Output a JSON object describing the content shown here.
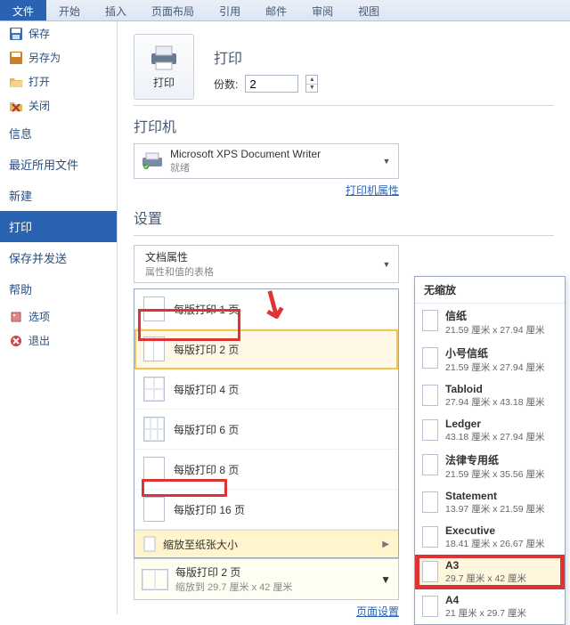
{
  "ribbon": {
    "tabs": [
      "文件",
      "开始",
      "插入",
      "页面布局",
      "引用",
      "邮件",
      "审阅",
      "视图"
    ],
    "active_index": 0
  },
  "left_menu": {
    "quick": [
      {
        "icon": "save-icon",
        "label": "保存"
      },
      {
        "icon": "saveas-icon",
        "label": "另存为"
      },
      {
        "icon": "open-icon",
        "label": "打开"
      },
      {
        "icon": "close-icon",
        "label": "关闭"
      }
    ],
    "sections": [
      "信息",
      "最近所用文件",
      "新建",
      "打印",
      "保存并发送",
      "帮助"
    ],
    "selected_section_index": 3,
    "footer": [
      {
        "icon": "options-icon",
        "label": "选项"
      },
      {
        "icon": "exit-icon",
        "label": "退出"
      }
    ]
  },
  "print": {
    "title": "打印",
    "button_label": "打印",
    "copies_label": "份数:",
    "copies_value": "2"
  },
  "printer": {
    "heading": "打印机",
    "name": "Microsoft XPS Document Writer",
    "status": "就绪",
    "props_link": "打印机属性"
  },
  "settings": {
    "heading": "设置",
    "doc_props": {
      "main": "文档属性",
      "sub": "属性和值的表格"
    },
    "pages_per_sheet": {
      "items": [
        "每版打印 1 页",
        "每版打印 2 页",
        "每版打印 4 页",
        "每版打印 6 页",
        "每版打印 8 页",
        "每版打印 16 页"
      ],
      "highlight_index": 1,
      "scale_label": "缩放至纸张大小"
    },
    "selected_summary": {
      "main": "每版打印 2 页",
      "sub": "缩放到 29.7 厘米 x 42 厘米"
    },
    "page_setup_link": "页面设置"
  },
  "paper_flyout": {
    "heading": "无缩放",
    "items": [
      {
        "name": "信纸",
        "dim": "21.59 厘米 x 27.94 厘米"
      },
      {
        "name": "小号信纸",
        "dim": "21.59 厘米 x 27.94 厘米"
      },
      {
        "name": "Tabloid",
        "dim": "27.94 厘米 x 43.18 厘米"
      },
      {
        "name": "Ledger",
        "dim": "43.18 厘米 x 27.94 厘米"
      },
      {
        "name": "法律专用纸",
        "dim": "21.59 厘米 x 35.56 厘米"
      },
      {
        "name": "Statement",
        "dim": "13.97 厘米 x 21.59 厘米"
      },
      {
        "name": "Executive",
        "dim": "18.41 厘米 x 26.67 厘米"
      },
      {
        "name": "A3",
        "dim": "29.7 厘米 x 42 厘米"
      },
      {
        "name": "A4",
        "dim": "21 厘米 x 29.7 厘米"
      }
    ],
    "selected_index": 7
  }
}
